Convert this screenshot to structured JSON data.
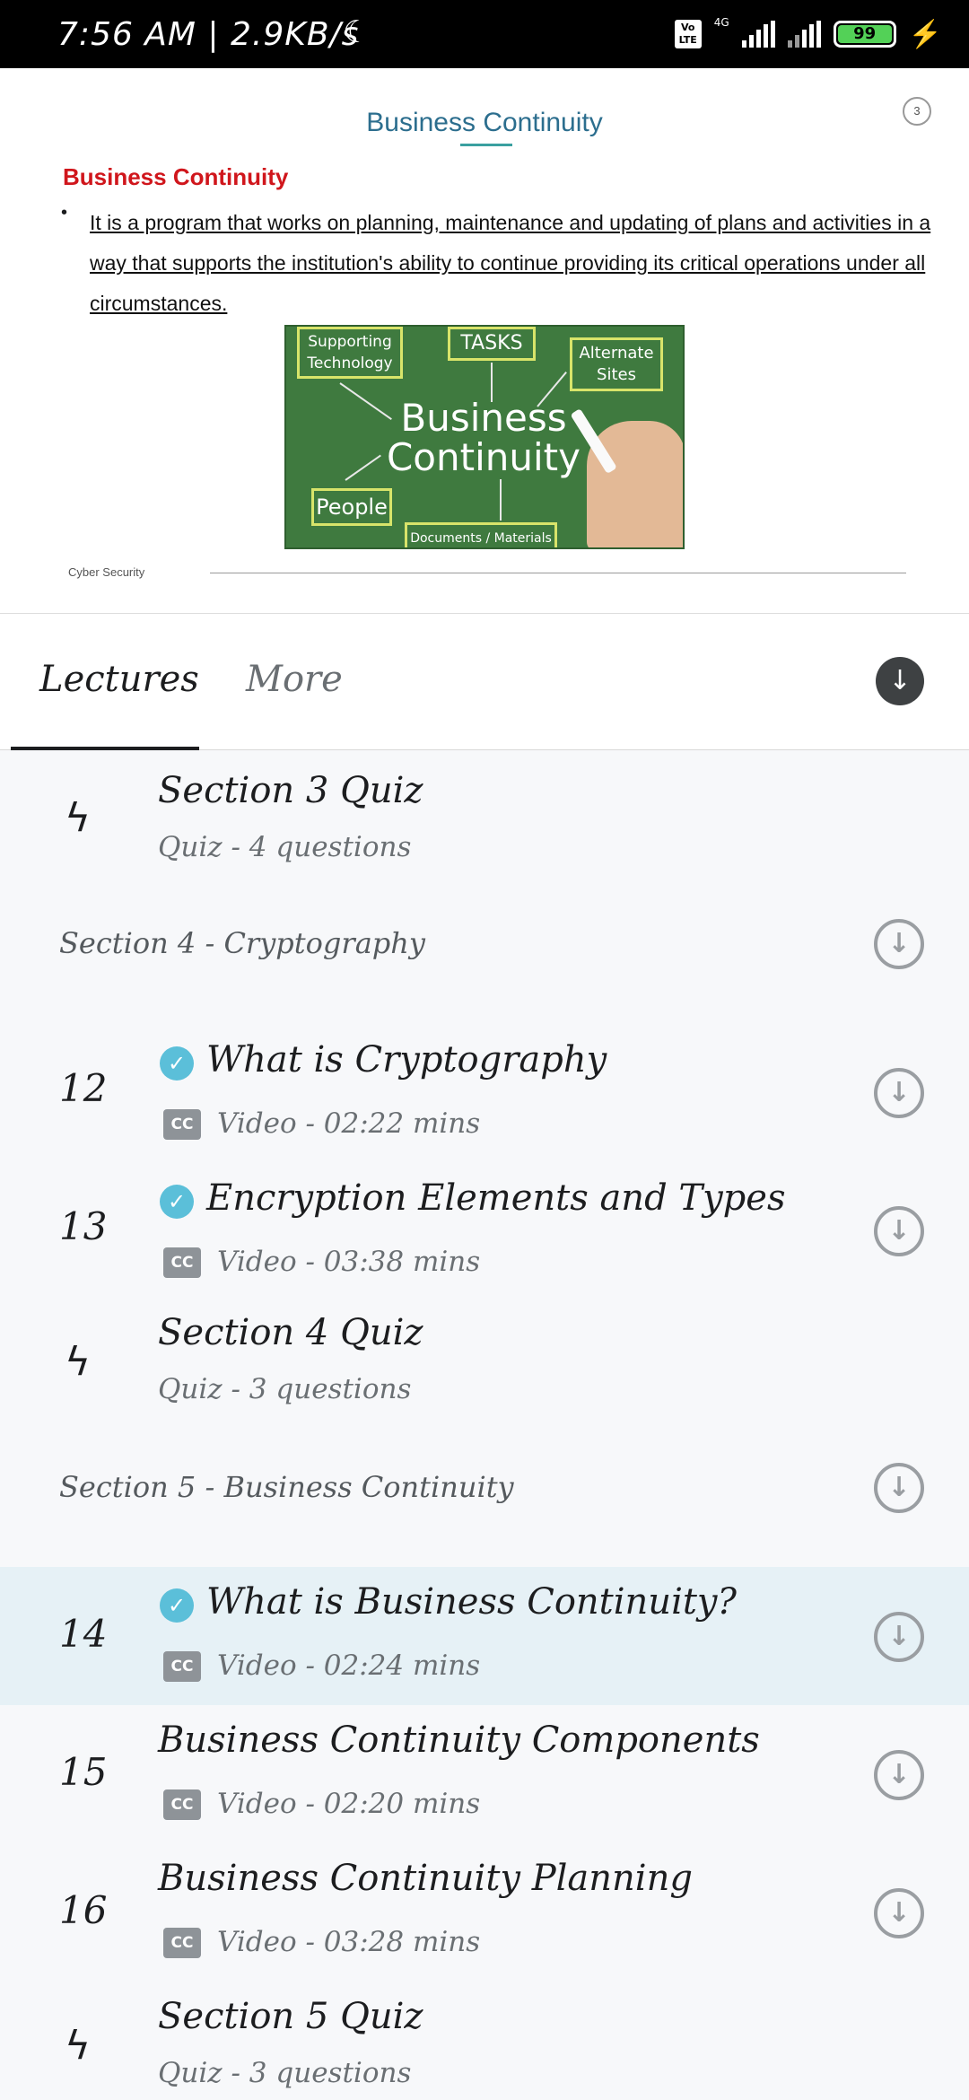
{
  "status_bar": {
    "time": "7:56 AM | 2.9KB/s",
    "volte": "Vo LTE",
    "network": "4G",
    "battery": "99"
  },
  "slide": {
    "title": "Business Continuity",
    "page_number": "3",
    "heading": "Business Continuity",
    "bullet_text": "It is a program that works on planning, maintenance and updating of plans and activities in a way that supports the institution's ability to continue providing its critical operations under all circumstances.",
    "image_labels": {
      "supporting_technology": "Supporting Technology",
      "tasks": "TASKS",
      "alternate_sites": "Alternate Sites",
      "center_line1": "Business",
      "center_line2": "Continuity",
      "people": "People",
      "documents": "Documents / Materials"
    },
    "footer": "Cyber Security"
  },
  "tabs": {
    "lectures": "Lectures",
    "more": "More"
  },
  "list": {
    "quiz3": {
      "title": "Section 3 Quiz",
      "meta": "Quiz - 4 questions"
    },
    "section4": "Section 4 - Cryptography",
    "l12": {
      "num": "12",
      "title": "What is Cryptography",
      "meta": "Video - 02:22 mins"
    },
    "l13": {
      "num": "13",
      "title": "Encryption Elements and Types",
      "meta": "Video - 03:38 mins"
    },
    "quiz4": {
      "title": "Section 4 Quiz",
      "meta": "Quiz - 3 questions"
    },
    "section5": "Section 5 - Business Continuity",
    "l14": {
      "num": "14",
      "title": "What is Business Continuity?",
      "meta": "Video - 02:24 mins"
    },
    "l15": {
      "num": "15",
      "title": "Business Continuity Components",
      "meta": "Video - 02:20 mins"
    },
    "l16": {
      "num": "16",
      "title": "Business Continuity Planning",
      "meta": "Video - 03:28 mins"
    },
    "quiz5": {
      "title": "Section 5 Quiz",
      "meta": "Quiz - 3 questions"
    },
    "cc_label": "CC"
  },
  "colors": {
    "accent_check": "#5bbfd9",
    "active_row": "#e6f1f6",
    "slide_heading": "#d0161c",
    "slide_title": "#2c6e8e"
  }
}
